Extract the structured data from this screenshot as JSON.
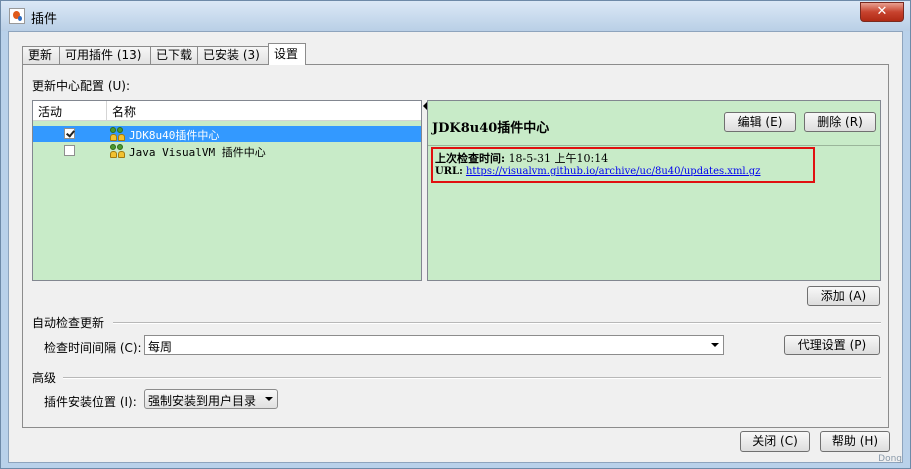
{
  "window": {
    "title": "插件",
    "close_label": "✕"
  },
  "tabs": [
    {
      "label": "更新"
    },
    {
      "label": "可用插件 (13)"
    },
    {
      "label": "已下载"
    },
    {
      "label": "已安装 (3)"
    },
    {
      "label": "设置"
    }
  ],
  "update_center": {
    "section_label": "更新中心配置 (U):",
    "columns": {
      "active": "活动",
      "name": "名称"
    },
    "rows": [
      {
        "name": "JDK8u40插件中心",
        "checked": true,
        "selected": true
      },
      {
        "name": "Java VisualVM 插件中心",
        "checked": false,
        "selected": false
      }
    ]
  },
  "detail": {
    "title": "JDK8u40插件中心",
    "edit_label": "编辑 (E)",
    "delete_label": "删除 (R)",
    "last_check_label": "上次检查时间:",
    "last_check_value": "18-5-31 上午10:14",
    "url_label": "URL:",
    "url_value": "https://visualvm.github.io/archive/uc/8u40/updates.xml.gz"
  },
  "add_label": "添加 (A)",
  "auto_check": {
    "section_label": "自动检查更新",
    "interval_label": "检查时间间隔 (C):",
    "interval_value": "每周",
    "proxy_label": "代理设置 (P)"
  },
  "advanced": {
    "section_label": "高级",
    "install_location_label": "插件安装位置 (I):",
    "install_location_value": "强制安装到用户目录"
  },
  "footer": {
    "close_label": "关闭 (C)",
    "help_label": "帮助 (H)"
  },
  "watermark": "Dong"
}
